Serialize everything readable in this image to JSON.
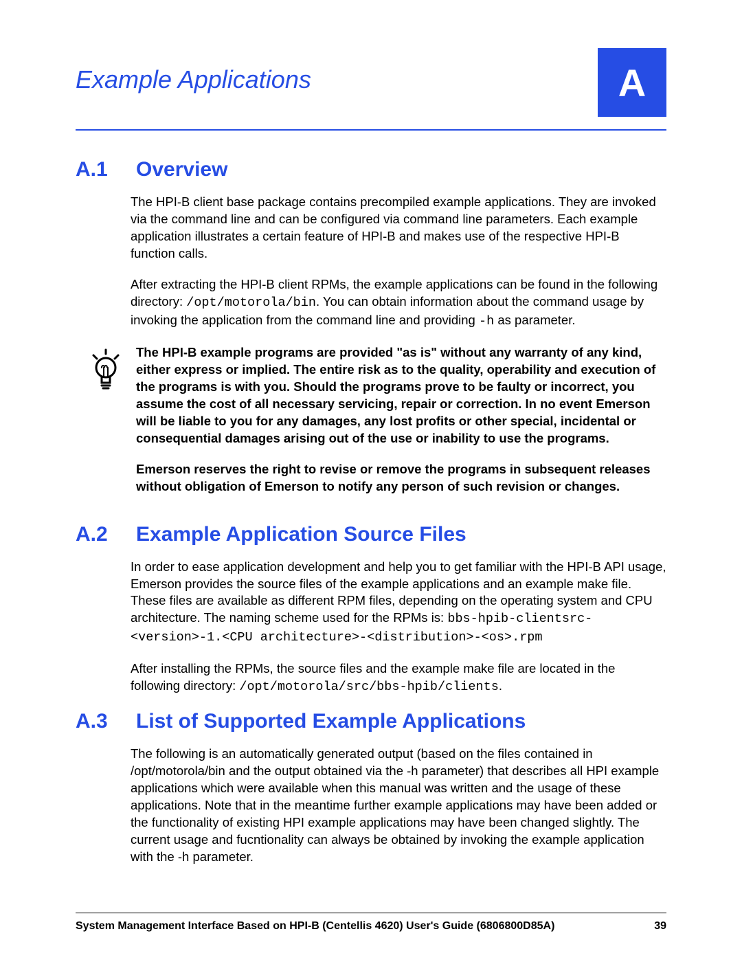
{
  "header": {
    "title": "Example Applications",
    "badge": "A"
  },
  "sections": {
    "a1": {
      "num": "A.1",
      "title": "Overview",
      "p1_a": "The HPI-B client base package contains precompiled example applications. They are invoked via the command line and can be configured via command line parameters. Each example application illustrates a certain feature of HPI-B and makes use of the respective HPI-B function calls.",
      "p2_a": "After extracting the HPI-B client RPMs, the example applications can be found in the following directory: ",
      "p2_code1": "/opt/motorola/bin",
      "p2_b": ". You can obtain information about the command usage by invoking the application from the command line and providing ",
      "p2_code2": "-h",
      "p2_c": " as parameter.",
      "note1": "The HPI-B example programs are provided \"as is\" without any warranty of any kind, either express or implied. The entire risk as to the quality, operability and execution of the programs is with you. Should the programs prove to be faulty or incorrect, you assume the cost of all necessary servicing, repair or correction. In no event Emerson will be liable to you for any damages, any lost profits or other special, incidental or consequential damages arising out of the use or inability to use the programs.",
      "note2": "Emerson reserves the right to revise or remove the programs in subsequent releases without obligation of Emerson to notify any person of such revision or changes."
    },
    "a2": {
      "num": "A.2",
      "title": "Example Application Source Files",
      "p1_a": "In order to ease application development and help you to get familiar with the HPI-B API usage, Emerson provides the source files of the example applications and an example make file. These files are available as different RPM files, depending on the operating system and CPU architecture. The naming scheme used for the RPMs is: ",
      "p1_code": "bbs-hpib-clientsrc-<version>-1.<CPU architecture>-<distribution>-<os>.rpm",
      "p2_a": "After installing the RPMs, the source files and the example make file are located in the following directory: ",
      "p2_code": "/opt/motorola/src/bbs-hpib/clients",
      "p2_b": "."
    },
    "a3": {
      "num": "A.3",
      "title": "List of Supported Example Applications",
      "p1": "The following is an automatically generated output (based on the files contained in /opt/motorola/bin and the output obtained via the -h parameter) that describes all HPI example applications which were available when this manual was written and the usage of these applications. Note that in the meantime further example applications may have been added or the functionality of existing HPI example applications may have been changed slightly. The current usage and fucntionality can always be obtained by invoking the example application with the -h parameter."
    }
  },
  "footer": {
    "left": "System Management Interface Based on HPI-B (Centellis 4620) User's Guide (6806800D85A)",
    "right": "39"
  }
}
